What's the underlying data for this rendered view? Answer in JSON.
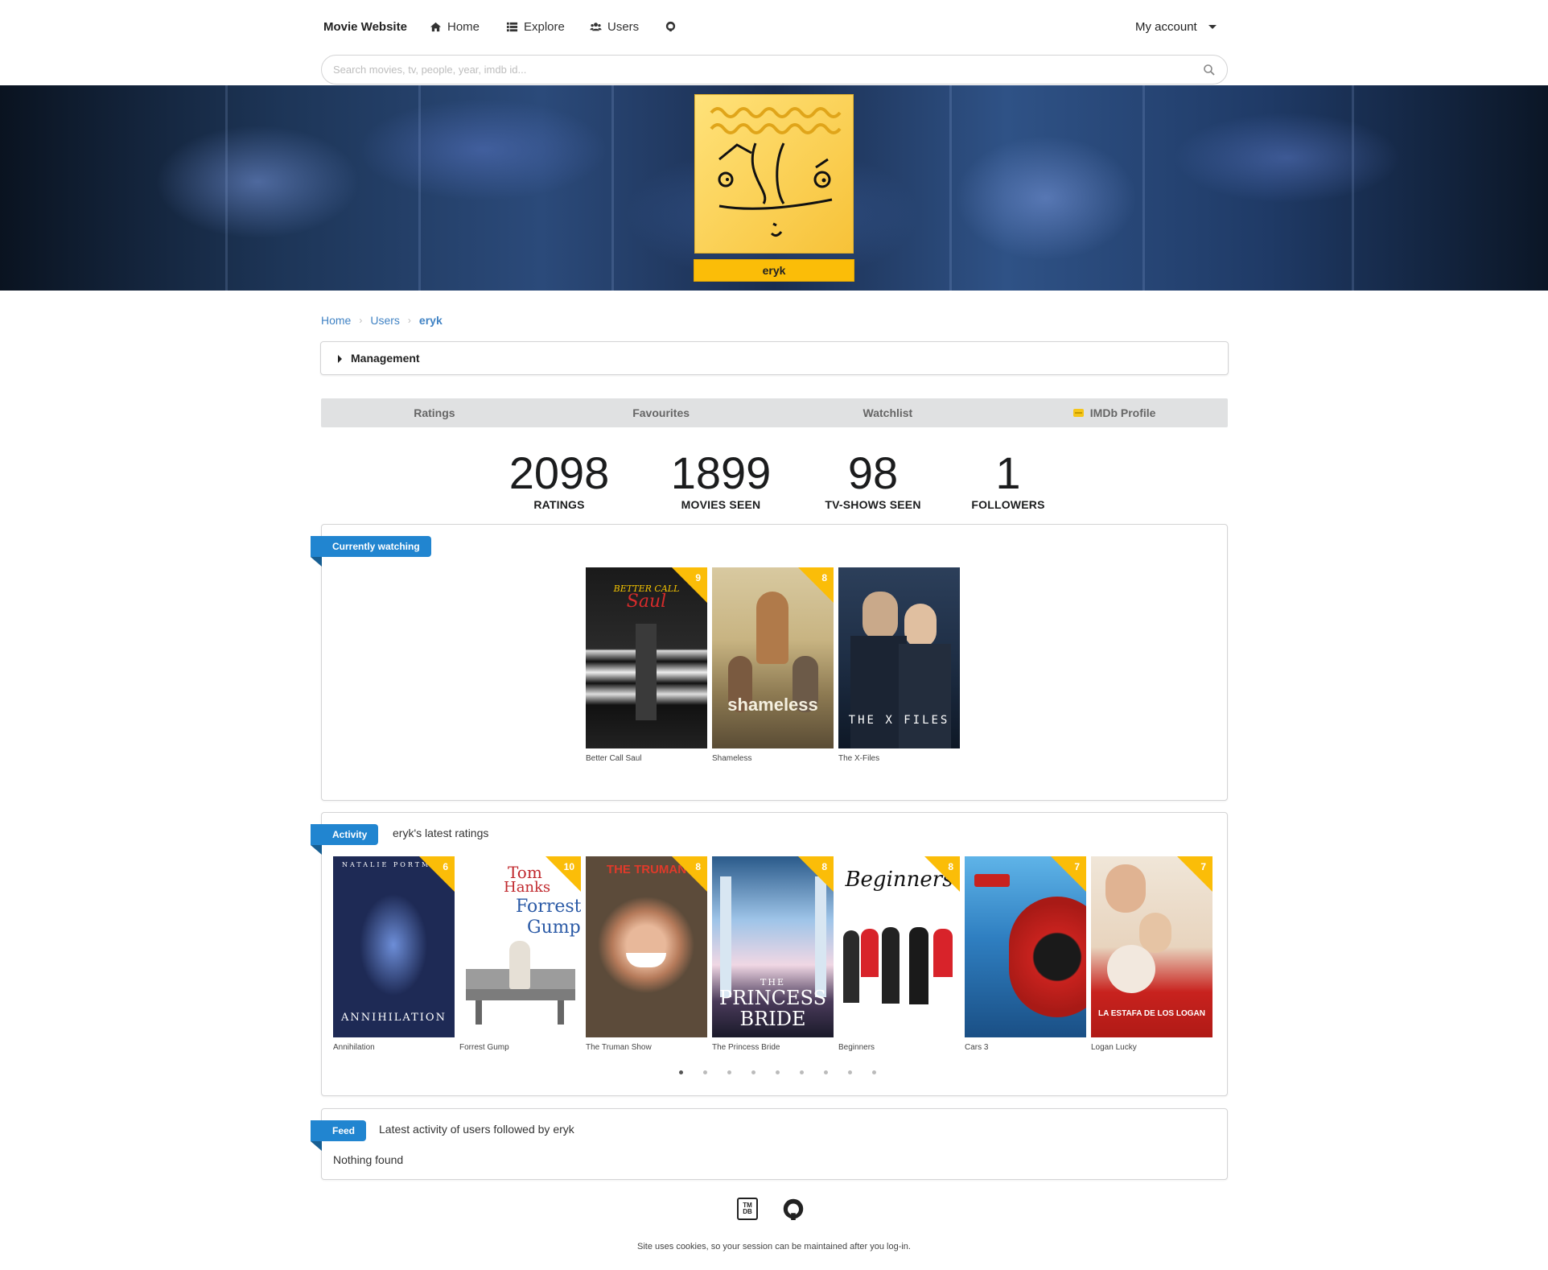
{
  "nav": {
    "brand": "Movie Website",
    "home": "Home",
    "explore": "Explore",
    "users": "Users",
    "account": "My account"
  },
  "search": {
    "placeholder": "Search movies, tv, people, year, imdb id..."
  },
  "profile": {
    "username": "eryk"
  },
  "breadcrumb": {
    "home": "Home",
    "users": "Users",
    "current": "eryk"
  },
  "management": {
    "label": "Management"
  },
  "tabs": [
    "Ratings",
    "Favourites",
    "Watchlist",
    "IMDb Profile"
  ],
  "stats": [
    {
      "value": "2098",
      "label": "RATINGS"
    },
    {
      "value": "1899",
      "label": "MOVIES SEEN"
    },
    {
      "value": "98",
      "label": "TV-SHOWS SEEN"
    },
    {
      "value": "1",
      "label": "FOLLOWERS"
    }
  ],
  "currently_watching": {
    "ribbon": "Currently watching",
    "items": [
      {
        "title": "Better Call Saul",
        "rating": "9"
      },
      {
        "title": "Shameless",
        "rating": "8"
      },
      {
        "title": "The X-Files",
        "rating": ""
      }
    ]
  },
  "activity": {
    "ribbon": "Activity",
    "subtitle": "eryk's latest ratings",
    "items": [
      {
        "title": "Annihilation",
        "rating": "6"
      },
      {
        "title": "Forrest Gump",
        "rating": "10"
      },
      {
        "title": "The Truman Show",
        "rating": "8"
      },
      {
        "title": "The Princess Bride",
        "rating": "8"
      },
      {
        "title": "Beginners",
        "rating": "8"
      },
      {
        "title": "Cars 3",
        "rating": "7"
      },
      {
        "title": "Logan Lucky",
        "rating": "7"
      }
    ],
    "pages": 9,
    "active_page": 1
  },
  "feed": {
    "ribbon": "Feed",
    "subtitle": "Latest activity of users followed by eryk",
    "empty": "Nothing found"
  },
  "poster_text": {
    "bcs": "BETTER CALL",
    "bcs2": "Saul",
    "shameless": "shameless",
    "xfiles": "THE X FILES",
    "annihilation": "ANNIHILATION",
    "annihilation_top": "NATALIE PORTMAN",
    "forrest1": "Tom",
    "forrest2": "Hanks",
    "forrest3": "Forrest",
    "forrest4": "Gump",
    "truman": "THE TRUMAN",
    "princess1": "THE",
    "princess2": "PRINCESS",
    "princess3": "BRIDE",
    "beginners": "Beginners",
    "logan": "LA ESTAFA DE LOS LOGAN"
  },
  "footer": {
    "tmdb": "TM DB",
    "cookies": "Site uses cookies, so your session can be maintained after you log-in."
  },
  "colors": {
    "accent_blue": "#2185d0",
    "rating_yellow": "#fbbd08",
    "link": "#4183c4"
  }
}
